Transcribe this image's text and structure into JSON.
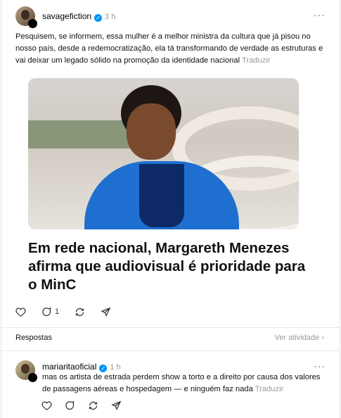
{
  "post": {
    "username": "savagefiction",
    "time": "3 h",
    "text": "Pesquisem, se informem, essa mulher é a melhor ministra da cultura que já pisou no nosso país, desde a redemocratização, ela tá transformando de verdade as estruturas e vai deixar um legado sólido na promoção da identidade nacional",
    "translate": "Traduzir",
    "headline": "Em rede nacional, Margareth Menezes afirma que audiovisual é prioridade para o MinC",
    "reply_count": "1"
  },
  "replies_section": {
    "label": "Respostas",
    "view_activity": "Ver atividade"
  },
  "reply": {
    "username": "mariaritaoficial",
    "time": "1 h",
    "text": "mas os artista de estrada perdem show a torto e a direito por causa dos valores de passagens aéreas e hospedagem — e ninguém faz nada",
    "translate": "Traduzir"
  },
  "icons": {
    "like": "heart-icon",
    "comment": "comment-icon",
    "repost": "repost-icon",
    "share": "share-icon",
    "more": "more-icon",
    "verified": "verified-icon"
  },
  "colors": {
    "verified": "#0095f6",
    "muted": "#999999",
    "jacket": "#1f6fd1"
  }
}
